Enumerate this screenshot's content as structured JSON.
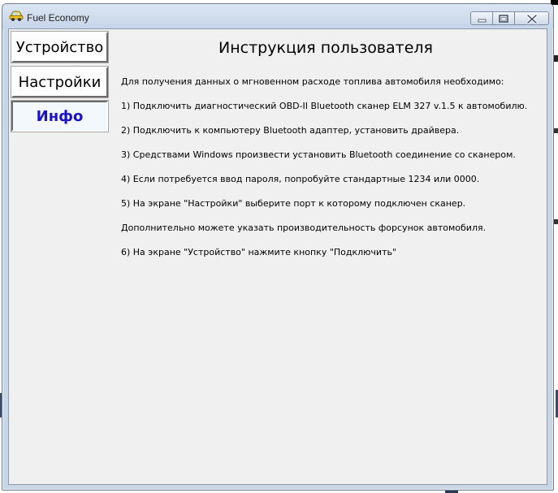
{
  "window": {
    "title": "Fuel Economy",
    "icon": "car-icon",
    "controls": [
      "minimize-icon",
      "maximize-icon",
      "close-icon"
    ]
  },
  "nav": {
    "device_label": "Устройство",
    "settings_label": "Настройки",
    "info_label": "Инфо",
    "active": "info",
    "active_color": "#1a12c8"
  },
  "main": {
    "title": "Инструкция пользователя",
    "lines": [
      "Для получения данных о мгновенном расходе топлива автомобиля необходимо:",
      "1) Подключить диагностический OBD-II Bluetooth сканер ELM 327 v.1.5 к автомобилю.",
      "2) Подключить к компьютеру Bluetooth адаптер, установить драйвера.",
      "3) Средствами Windows произвести установить Bluetooth соединение со сканером.",
      "4) Если потребуется ввод пароля, попробуйте стандартные 1234 или 0000.",
      "5) На экране \"Настройки\" выберите порт к которому подключен сканер.",
      "Дополнительно можете указать производительность форсунок автомобиля.",
      "6) На экране \"Устройство\" нажмите кнопку \"Подключить\""
    ]
  }
}
